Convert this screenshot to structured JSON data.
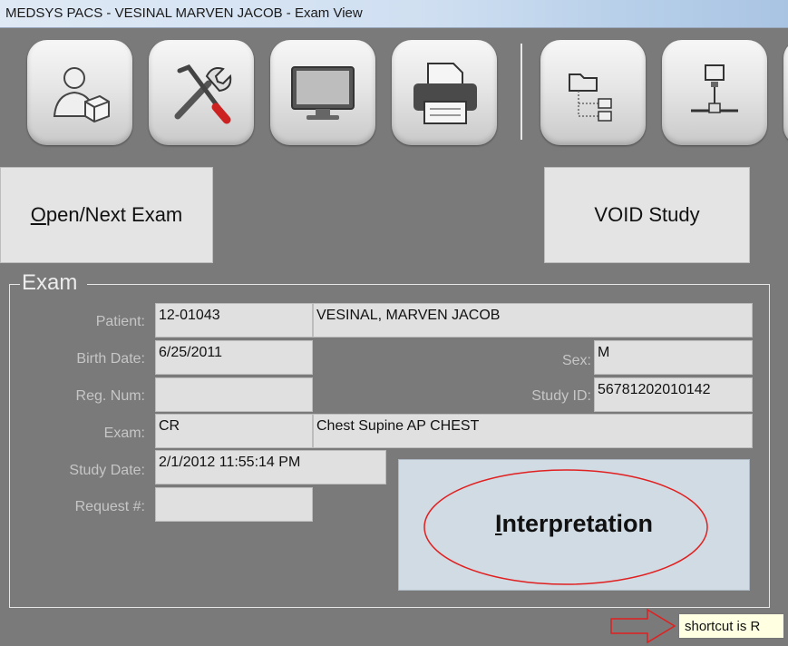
{
  "window": {
    "title": "MEDSYS PACS - VESINAL MARVEN JACOB - Exam View"
  },
  "toolbar": {
    "icons": [
      "user-package-icon",
      "tools-icon",
      "monitor-icon",
      "printer-icon",
      "folder-tree-icon",
      "network-icon"
    ]
  },
  "actions": {
    "open_next_mnemonic": "O",
    "open_next_rest": "pen/Next Exam",
    "void_study": "VOID Study"
  },
  "exam": {
    "legend": "Exam",
    "labels": {
      "patient": "Patient:",
      "birth_date": "Birth Date:",
      "reg_num": "Reg. Num:",
      "exam": "Exam:",
      "study_date": "Study Date:",
      "request": "Request #:",
      "sex": "Sex:",
      "study_id": "Study ID:"
    },
    "patient_id": "12-01043",
    "patient_name": "VESINAL, MARVEN JACOB",
    "birth_date": "6/25/2011",
    "sex": "M",
    "reg_num": "",
    "study_id": "56781202010142",
    "modality": "CR",
    "exam_desc": "Chest Supine AP CHEST",
    "study_date": "2/1/2012 11:55:14 PM",
    "request_num": ""
  },
  "interpretation": {
    "mnemonic": "I",
    "rest": "nterpretation"
  },
  "annotation": {
    "tooltip": "shortcut is R",
    "highlight_color": "#e02020"
  }
}
